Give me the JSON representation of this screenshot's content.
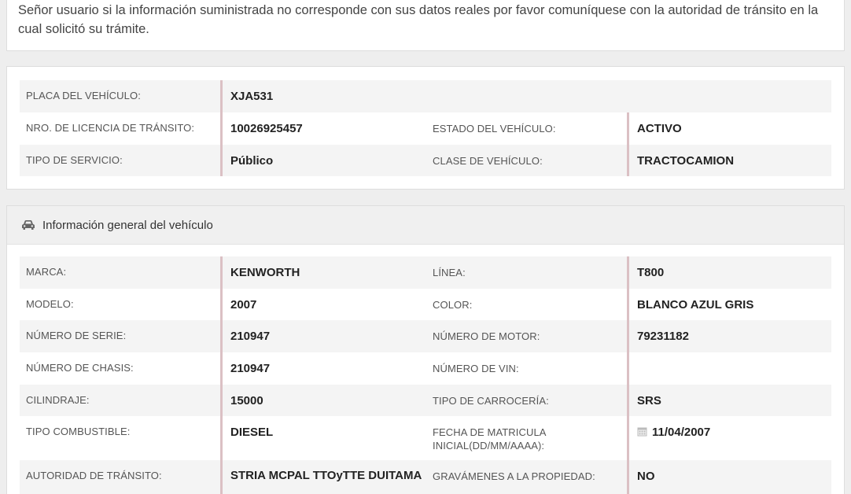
{
  "notice": "Señor usuario si la información suministrada no corresponde con sus datos reales por favor comuníquese con la autoridad de tránsito en la cual solicitó su trámite.",
  "summary": {
    "placa_label": "PLACA DEL VEHÍCULO:",
    "placa": "XJA531",
    "licencia_label": "NRO. DE LICENCIA DE TRÁNSITO:",
    "licencia": "10026925457",
    "estado_label": "ESTADO DEL VEHÍCULO:",
    "estado": "ACTIVO",
    "servicio_label": "TIPO DE SERVICIO:",
    "servicio": "Público",
    "clase_label": "CLASE DE VEHÍCULO:",
    "clase": "TRACTOCAMION"
  },
  "general": {
    "title": "Información general del vehículo",
    "icon": "car-icon",
    "marca_label": "MARCA:",
    "marca": "KENWORTH",
    "linea_label": "LÍNEA:",
    "linea": "T800",
    "modelo_label": "MODELO:",
    "modelo": "2007",
    "color_label": "COLOR:",
    "color": "BLANCO AZUL GRIS",
    "serie_label": "NÚMERO DE SERIE:",
    "serie": "210947",
    "motor_label": "NÚMERO DE MOTOR:",
    "motor": "79231182",
    "chasis_label": "NÚMERO DE CHASIS:",
    "chasis": "210947",
    "vin_label": "NÚMERO DE VIN:",
    "vin": "",
    "cilindraje_label": "CILINDRAJE:",
    "cilindraje": "15000",
    "carroceria_label": "TIPO DE CARROCERÍA:",
    "carroceria": "SRS",
    "combustible_label": "TIPO COMBUSTIBLE:",
    "combustible": "DIESEL",
    "fecha_label": "FECHA DE MATRICULA INICIAL(DD/MM/AAAA):",
    "fecha": "11/04/2007",
    "autoridad_label": "AUTORIDAD DE TRÁNSITO:",
    "autoridad": "STRIA MCPAL TTOyTTE DUITAMA",
    "gravamenes_label": "GRAVÁMENES A LA PROPIEDAD:",
    "gravamenes": "NO"
  },
  "colors": {
    "accent_border": "#dbc0c4",
    "row_shade": "#f4f4f4",
    "header_bg": "#f0f0f0"
  }
}
